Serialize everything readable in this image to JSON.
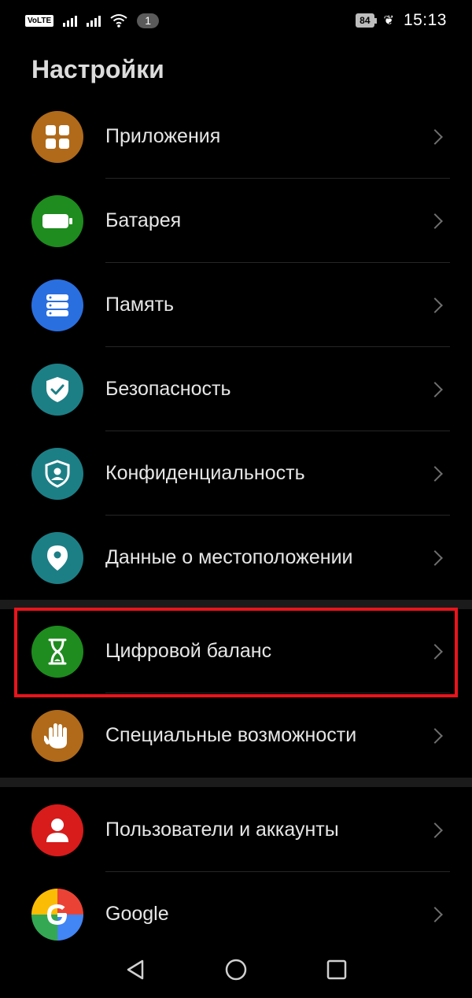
{
  "statusbar": {
    "volte": "VoLTE",
    "notification_count": "1",
    "battery_level": "84",
    "time": "15:13"
  },
  "page": {
    "title": "Настройки"
  },
  "items": [
    {
      "label": "Приложения",
      "icon": "apps-grid-icon",
      "color": "#b06a1a"
    },
    {
      "label": "Батарея",
      "icon": "battery-icon",
      "color": "#1e8c1e"
    },
    {
      "label": "Память",
      "icon": "storage-icon",
      "color": "#2a6fe0"
    },
    {
      "label": "Безопасность",
      "icon": "shield-check-icon",
      "color": "#1d7f86"
    },
    {
      "label": "Конфиденциальность",
      "icon": "privacy-shield-icon",
      "color": "#1d7f86"
    },
    {
      "label": "Данные о местоположении",
      "icon": "location-pin-icon",
      "color": "#1d7f86"
    },
    {
      "label": "Цифровой баланс",
      "icon": "hourglass-icon",
      "color": "#1e8c1e"
    },
    {
      "label": "Специальные возможности",
      "icon": "hand-icon",
      "color": "#b06a1a"
    },
    {
      "label": "Пользователи и аккаунты",
      "icon": "user-icon",
      "color": "#d81b1b"
    },
    {
      "label": "Google",
      "icon": "google-icon",
      "color": "#ffffff"
    }
  ],
  "highlight_color": "#e8141c",
  "navigation": {
    "back": "back-icon",
    "home": "home-icon",
    "recents": "recents-icon"
  }
}
